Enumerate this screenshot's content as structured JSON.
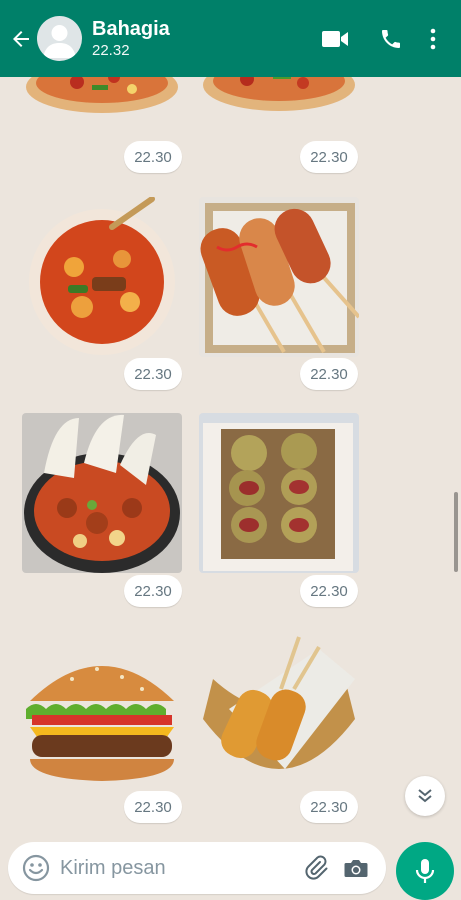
{
  "header": {
    "back_icon": "arrow-left-icon",
    "contact_name": "Bahagia",
    "status": "22.32",
    "actions": [
      "video-call-icon",
      "phone-icon",
      "more-vert-icon"
    ],
    "color": "#008069"
  },
  "messages": [
    {
      "type": "sticker",
      "subject": "pizza",
      "time": "22.30"
    },
    {
      "type": "sticker",
      "subject": "pizza",
      "time": "22.30"
    },
    {
      "type": "sticker",
      "subject": "seblak soup bowl",
      "time": "22.30"
    },
    {
      "type": "sticker",
      "subject": "corn dogs with sauce",
      "time": "22.30"
    },
    {
      "type": "sticker",
      "subject": "meatball bowl with crackers",
      "time": "22.30"
    },
    {
      "type": "sticker",
      "subject": "mini pizzas in box",
      "time": "22.30"
    },
    {
      "type": "sticker",
      "subject": "cheeseburger",
      "time": "22.30"
    },
    {
      "type": "sticker",
      "subject": "potato corn dogs",
      "time": "22.30"
    }
  ],
  "composer": {
    "placeholder": "Kirim pesan",
    "emoji_icon": "emoji-icon",
    "attach_icon": "paperclip-icon",
    "camera_icon": "camera-icon",
    "mic_icon": "mic-icon",
    "accent": "#00a884"
  },
  "scroll_down_icon": "double-chevron-down-icon"
}
